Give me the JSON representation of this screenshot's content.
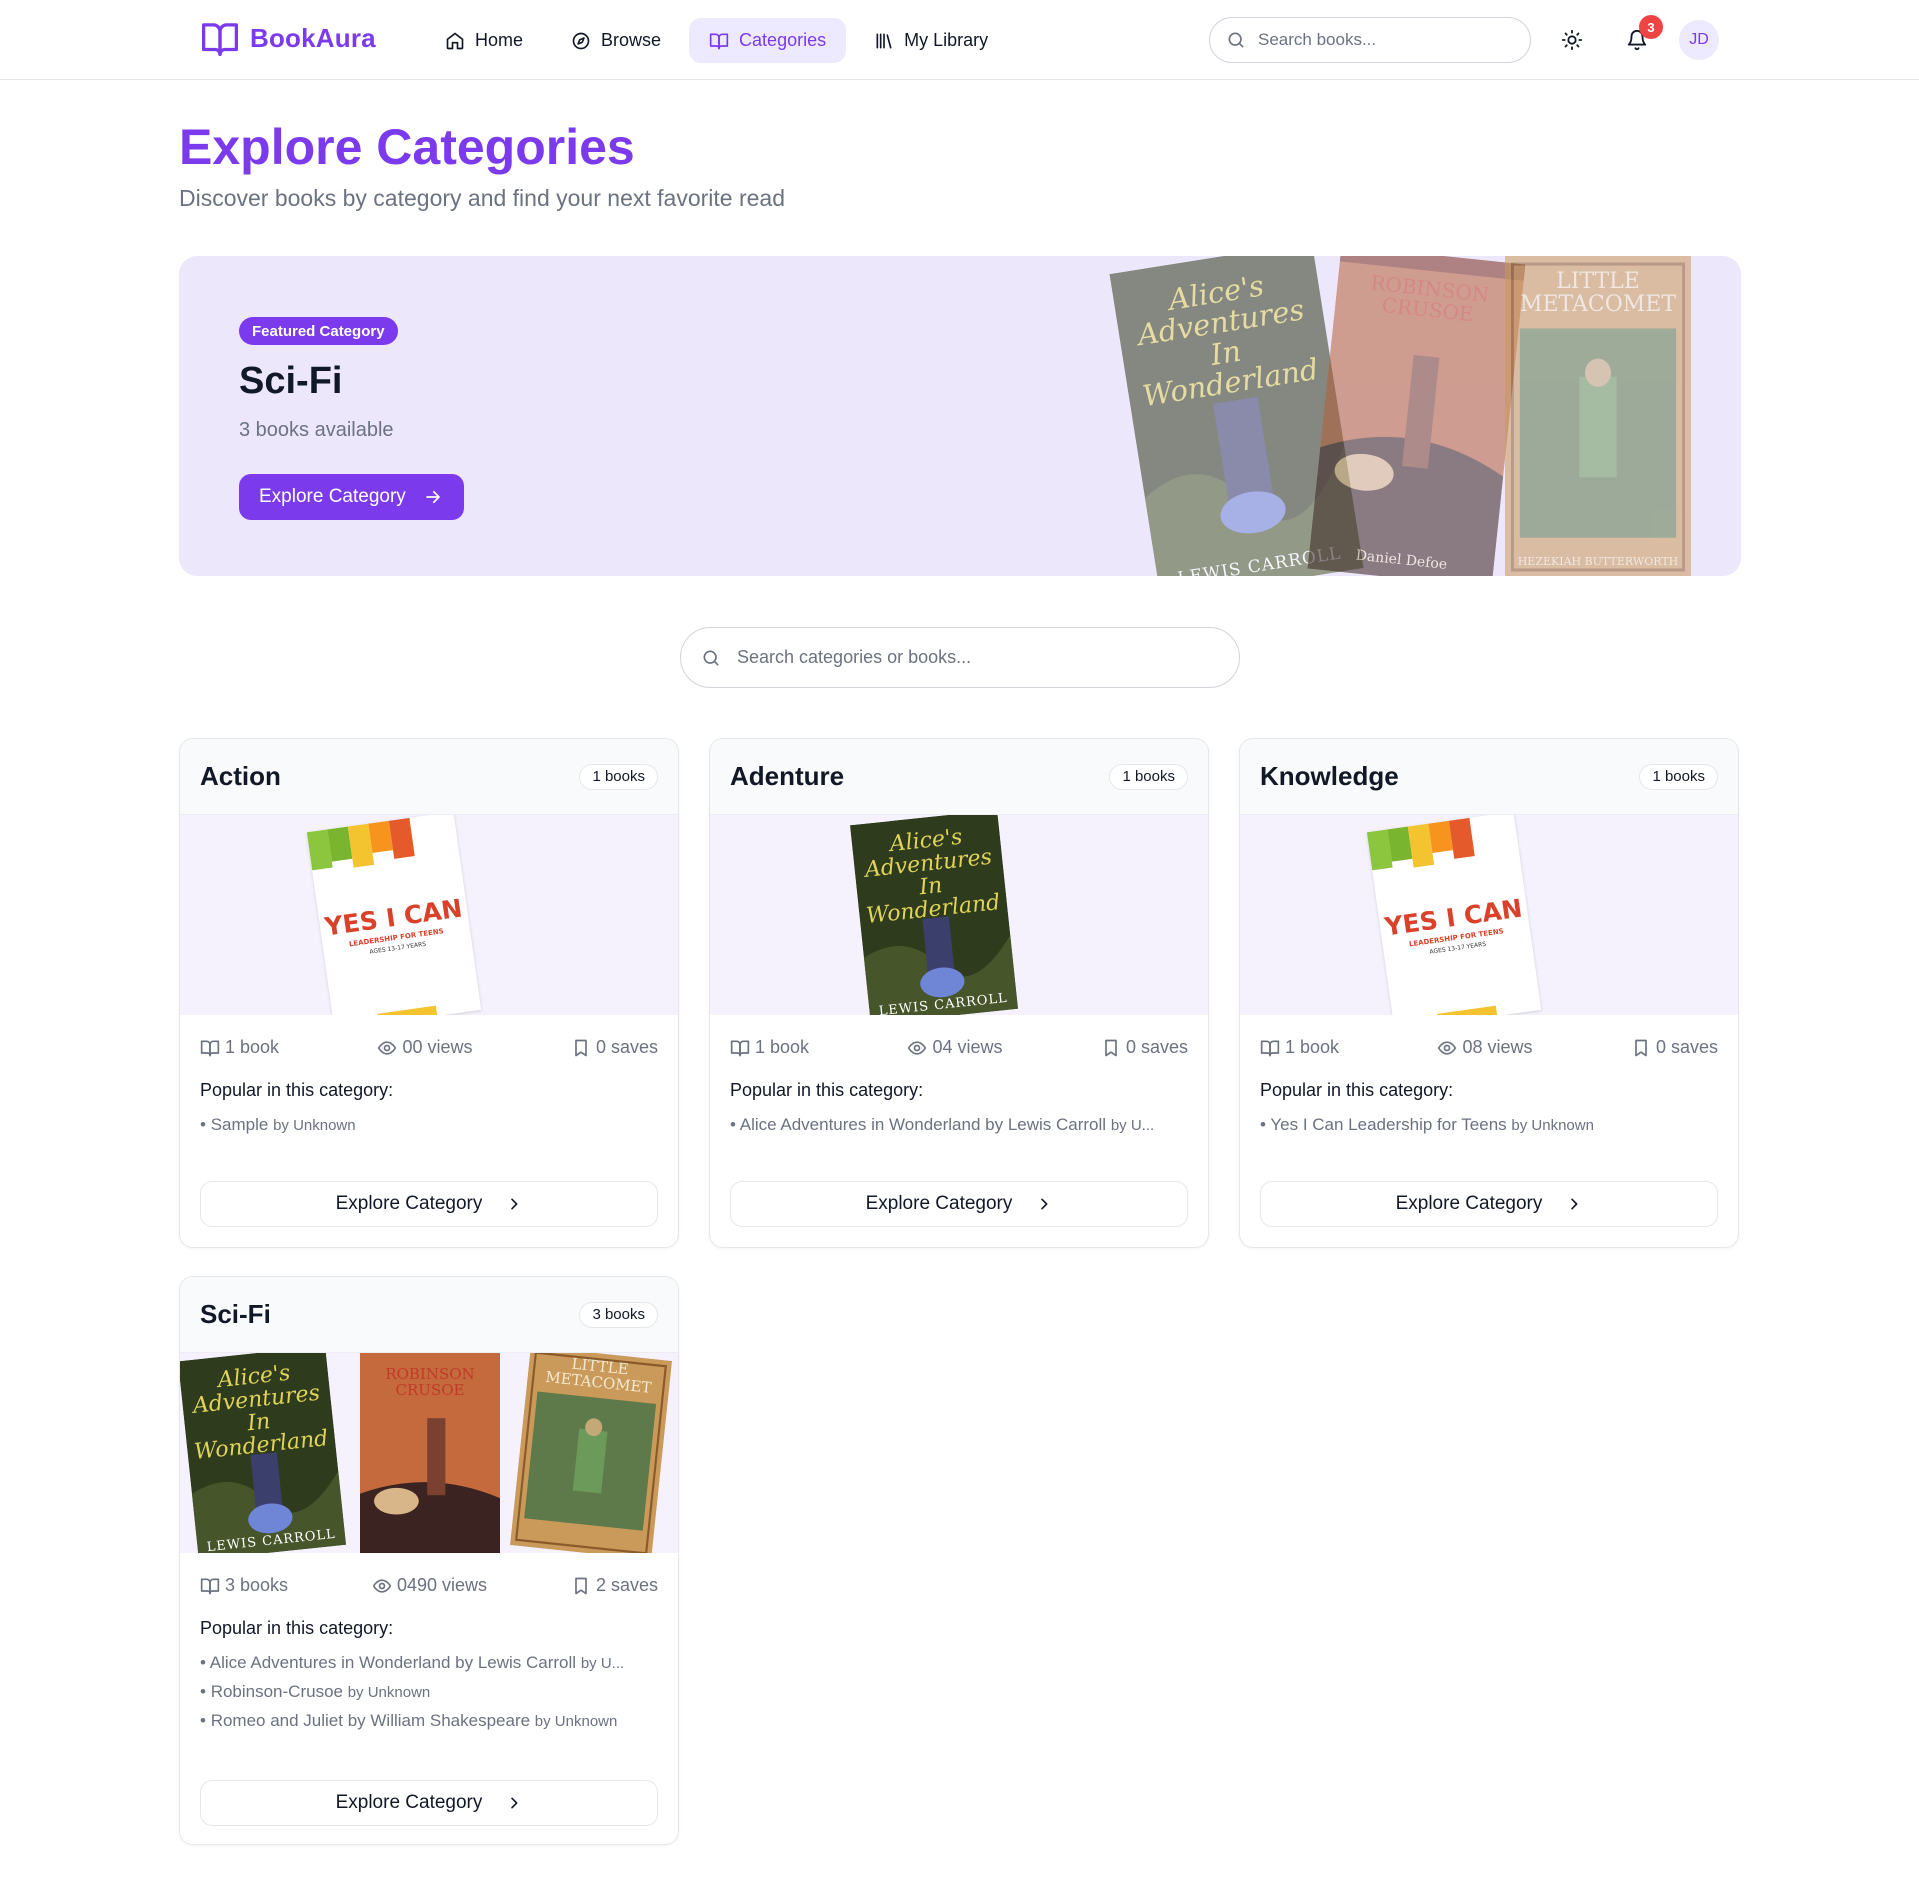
{
  "app": {
    "name": "BookAura"
  },
  "nav": {
    "items": [
      {
        "label": "Home",
        "icon": "home-icon"
      },
      {
        "label": "Browse",
        "icon": "compass-icon"
      },
      {
        "label": "Categories",
        "icon": "book-open-icon",
        "active": true
      },
      {
        "label": "My Library",
        "icon": "library-icon"
      }
    ]
  },
  "header": {
    "search_placeholder": "Search books...",
    "notifications_count": "3",
    "avatar_initials": "JD"
  },
  "page": {
    "title": "Explore Categories",
    "subtitle": "Discover books by category and find your next favorite read"
  },
  "featured": {
    "pill": "Featured Category",
    "title": "Sci-Fi",
    "count": "3 books available",
    "button": "Explore Category",
    "covers": [
      {
        "title": "Alice's Adventures In Wonderland",
        "author": "LEWIS CARROLL"
      },
      {
        "title": "ROBINSON CRUSOE",
        "author": "Daniel Defoe"
      },
      {
        "title": "LITTLE METACOMET",
        "author": "HEZEKIAH BUTTERWORTH"
      }
    ]
  },
  "category_search": {
    "placeholder": "Search categories or books..."
  },
  "popular_label": "Popular in this category:",
  "explore_label": "Explore Category",
  "categories": [
    {
      "name": "Action",
      "count_badge": "1 books",
      "books": "1 book",
      "views": "00 views",
      "saves": "0 saves",
      "popular": [
        {
          "title": "Sample",
          "by": "by Unknown"
        }
      ],
      "covers": [
        {
          "title": "YES I CAN",
          "subtitle": "LEADERSHIP FOR TEENS",
          "small": "AGES 13-17 YEARS"
        }
      ]
    },
    {
      "name": "Adenture",
      "count_badge": "1 books",
      "books": "1 book",
      "views": "04 views",
      "saves": "0 saves",
      "popular": [
        {
          "title": "Alice Adventures in Wonderland by Lewis Carroll",
          "by": "by U..."
        }
      ],
      "covers": [
        {
          "title": "Alice's Adventures In Wonderland",
          "author": "LEWIS CARROLL"
        }
      ]
    },
    {
      "name": "Knowledge",
      "count_badge": "1 books",
      "books": "1 book",
      "views": "08 views",
      "saves": "0 saves",
      "popular": [
        {
          "title": "Yes I Can Leadership for Teens",
          "by": "by Unknown"
        }
      ],
      "covers": [
        {
          "title": "YES I CAN",
          "subtitle": "LEADERSHIP FOR TEENS",
          "small": "AGES 13-17 YEARS"
        }
      ]
    },
    {
      "name": "Sci-Fi",
      "count_badge": "3 books",
      "books": "3 books",
      "views": "0490 views",
      "saves": "2 saves",
      "popular": [
        {
          "title": "Alice Adventures in Wonderland by Lewis Carroll",
          "by": "by U..."
        },
        {
          "title": "Robinson-Crusoe",
          "by": "by Unknown"
        },
        {
          "title": "Romeo and Juliet by William Shakespeare",
          "by": "by Unknown"
        }
      ],
      "covers": [
        {
          "title": "Alice's Adventures In Wonderland",
          "author": "LEWIS CARROLL"
        },
        {
          "title": "ROBINSON CRUSOE",
          "author": "Daniel Defoe"
        },
        {
          "title": "LITTLE METACOMET",
          "author": "HEZEKIAH BUTTERWORTH"
        }
      ]
    }
  ],
  "colors": {
    "accent": "#7c3aed",
    "accent_soft": "#ede9fe",
    "badge": "#ef4444",
    "muted": "#6b7280"
  }
}
